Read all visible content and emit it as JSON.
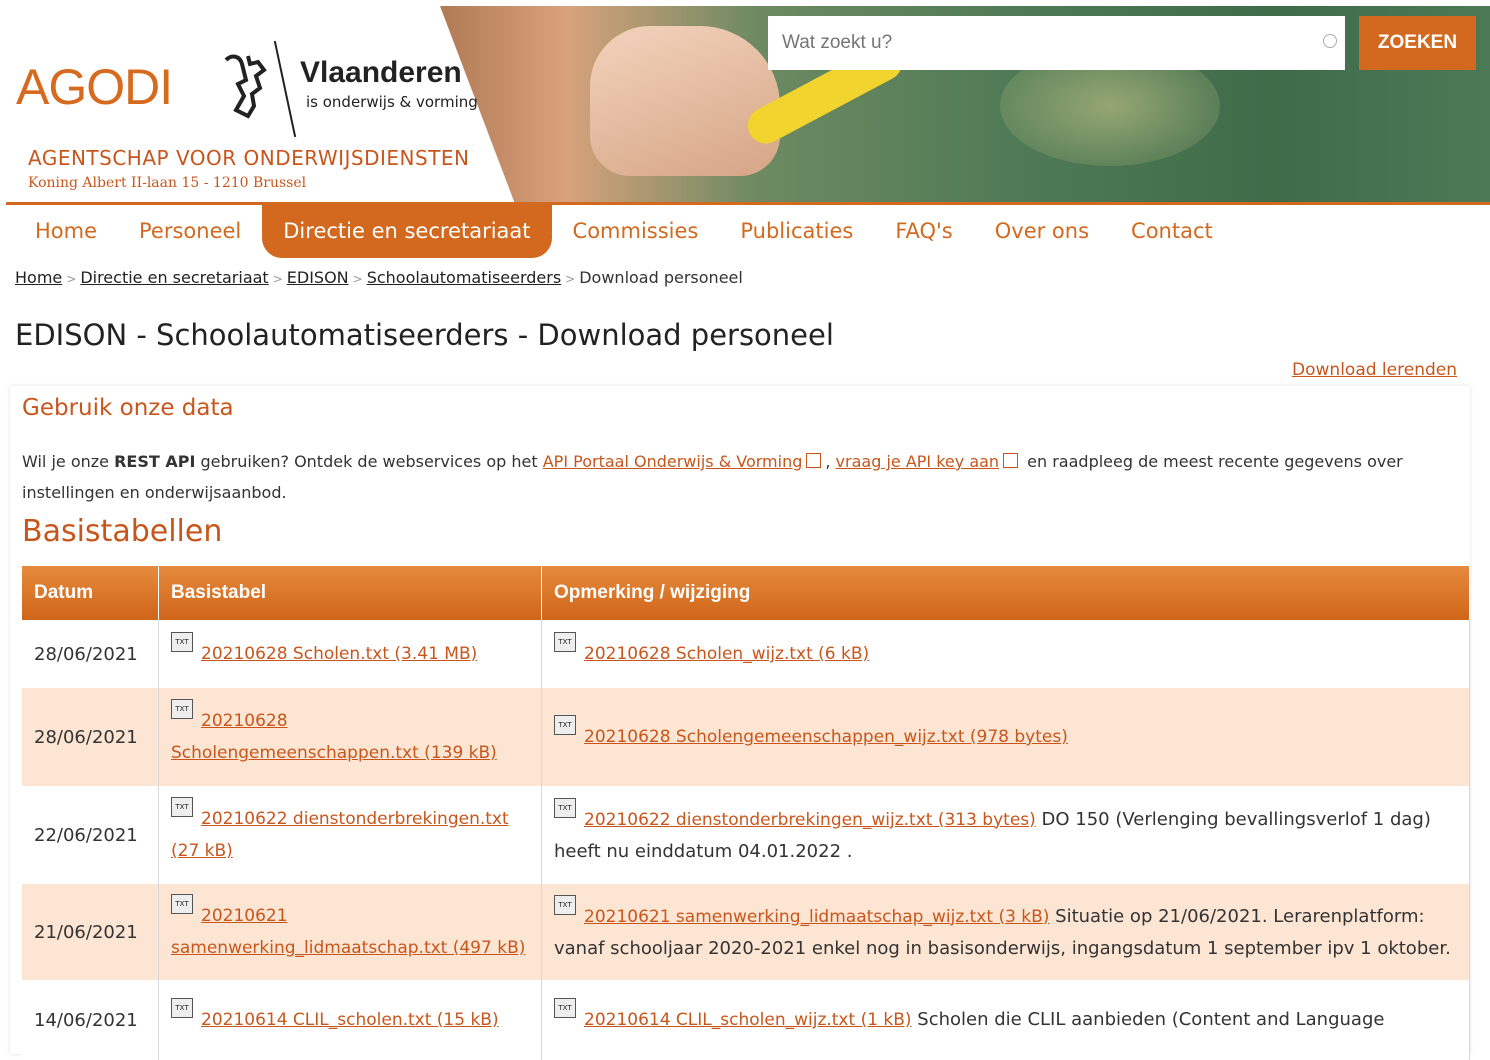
{
  "header": {
    "logo": "AGODI",
    "vlaanderen": "Vlaanderen",
    "vlaanderen_sub": "is onderwijs & vorming",
    "agency": "AGENTSCHAP VOOR ONDERWIJSDIENSTEN",
    "address": "Koning Albert II-laan 15 - 1210 Brussel",
    "search_placeholder": "Wat zoekt u?",
    "search_button": "ZOEKEN"
  },
  "nav": [
    "Home",
    "Personeel",
    "Directie en secretariaat",
    "Commissies",
    "Publicaties",
    "FAQ's",
    "Over ons",
    "Contact"
  ],
  "nav_active": "Directie en secretariaat",
  "breadcrumb": {
    "items": [
      "Home",
      "Directie en secretariaat",
      "EDISON",
      "Schoolautomatiseerders"
    ],
    "current": "Download personeel"
  },
  "page_title": "EDISON - Schoolautomatiseerders - Download personeel",
  "download_link": "Download lerenden",
  "section_data": {
    "title": "Gebruik onze data",
    "text1": "Wil je onze ",
    "bold": "REST API",
    "text2": " gebruiken? Ontdek de webservices op het ",
    "link1": "API Portaal Onderwijs & Vorming",
    "text3": ", ",
    "link2": "vraag je API key aan",
    "text4": " en raadpleeg de meest recente gegevens over instellingen en onderwijsaanbod."
  },
  "section_basis": {
    "title": "Basistabellen",
    "columns": [
      "Datum",
      "Basistabel",
      "Opmerking / wijziging"
    ],
    "rows": [
      {
        "date": "28/06/2021",
        "file": "20210628 Scholen.txt (3.41 MB)",
        "change": "20210628 Scholen_wijz.txt (6 kB)",
        "note": ""
      },
      {
        "date": "28/06/2021",
        "file": "20210628 Scholengemeenschappen.txt (139 kB)",
        "change": "20210628 Scholengemeenschappen_wijz.txt (978 bytes)",
        "note": ""
      },
      {
        "date": "22/06/2021",
        "file": "20210622 dienstonderbrekingen.txt (27 kB)",
        "change": "20210622 dienstonderbrekingen_wijz.txt (313 bytes)",
        "note": " DO 150 (Verlenging bevallingsverlof 1 dag) heeft nu einddatum 04.01.2022 ."
      },
      {
        "date": "21/06/2021",
        "file": "20210621 samenwerking_lidmaatschap.txt (497 kB)",
        "change": "20210621 samenwerking_lidmaatschap_wijz.txt (3 kB)",
        "note": "  Situatie op 21/06/2021. Lerarenplatform: vanaf schooljaar 2020-2021 enkel nog in basisonderwijs, ingangsdatum 1 september ipv 1 oktober."
      },
      {
        "date": "14/06/2021",
        "file": "20210614 CLIL_scholen.txt (15 kB)",
        "change": "20210614 CLIL_scholen_wijz.txt (1 kB)",
        "note": " Scholen die CLIL aanbieden (Content and Language"
      }
    ]
  },
  "icons": {
    "txt": "TXT"
  },
  "colors": {
    "accent": "#d2691e",
    "row_alt": "#fde5d3"
  }
}
